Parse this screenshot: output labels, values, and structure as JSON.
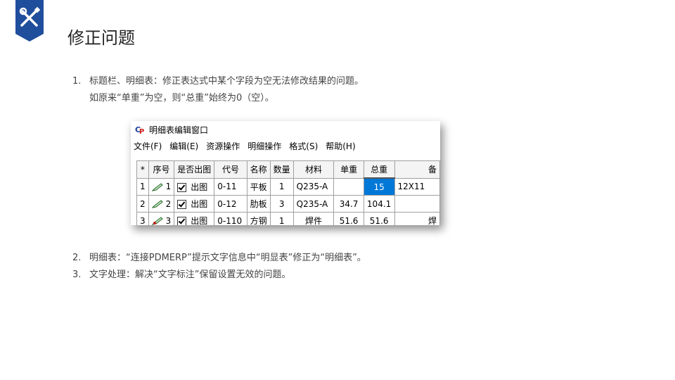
{
  "page": {
    "title": "修正问题"
  },
  "list": [
    {
      "num": "1.",
      "text": "标题栏、明细表：修正表达式中某个字段为空无法修改结果的问题。",
      "sub": "如原来“单重”为空，则“总重”始终为0（空）。"
    },
    {
      "num": "2.",
      "text": "明细表：“连接PDMERP”提示文字信息中“明显表”修正为“明细表”。"
    },
    {
      "num": "3.",
      "text": "文字处理：解决“文字标注”保留设置无效的问题。"
    }
  ],
  "window": {
    "title": "明细表编辑窗口",
    "menu": [
      "文件(F)",
      "编辑(E)",
      "资源操作",
      "明细操作",
      "格式(S)",
      "帮助(H)"
    ],
    "headers": [
      "*",
      "序号",
      "是否出图",
      "代号",
      "名称",
      "数量",
      "材料",
      "单重",
      "总重",
      "备"
    ],
    "rows": [
      {
        "rownum": "1",
        "seq": "1",
        "out": "出图",
        "code": "0-11",
        "name": "平板",
        "qty": "1",
        "mat": "Q235-A",
        "unit": "",
        "total": "15",
        "note": "12X11"
      },
      {
        "rownum": "2",
        "seq": "2",
        "out": "出图",
        "code": "0-12",
        "name": "肋板",
        "qty": "3",
        "mat": "Q235-A",
        "unit": "34.7",
        "total": "104.1",
        "note": ""
      },
      {
        "rownum": "3",
        "seq": "3",
        "out": "出图",
        "code": "0-110",
        "name": "方钢",
        "qty": "1",
        "mat": "焊件",
        "unit": "51.6",
        "total": "51.6",
        "note": "焊"
      }
    ]
  },
  "colors": {
    "badge": "#1f4e9c",
    "selection": "#0078d7"
  }
}
